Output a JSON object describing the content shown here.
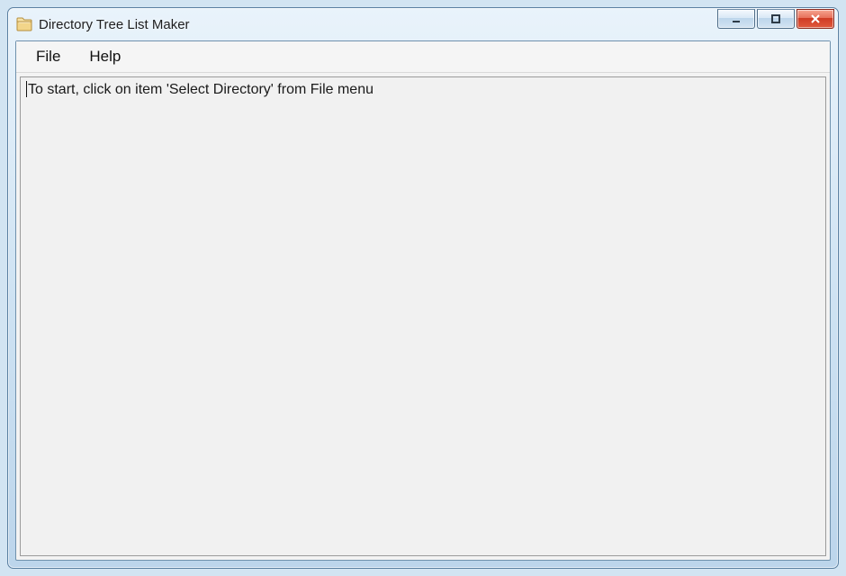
{
  "window": {
    "title": "Directory Tree List Maker"
  },
  "menu": {
    "file": "File",
    "help": "Help"
  },
  "content": {
    "placeholder_text": "To start, click on item 'Select Directory' from File menu"
  }
}
